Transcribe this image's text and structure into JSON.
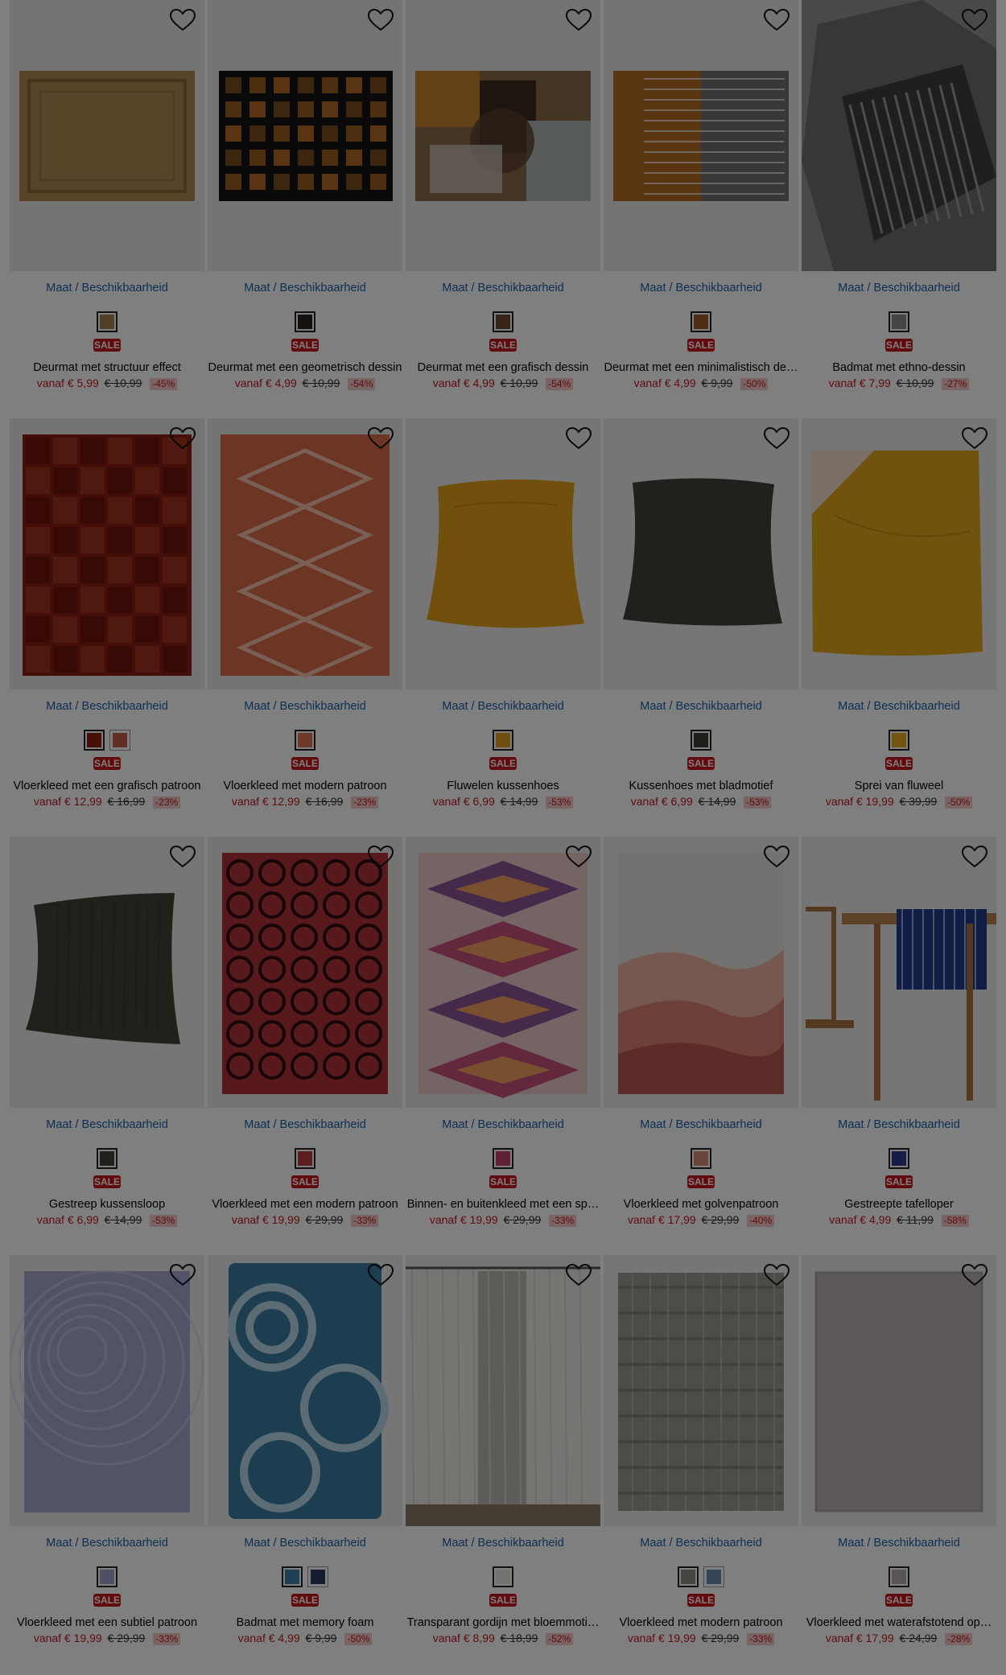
{
  "common": {
    "size_link": "Maat / Beschikbaarheid",
    "sale_badge": "SALE"
  },
  "products": [
    {
      "title": "Deurmat met structuur effect",
      "price": "vanaf € 5,99",
      "old": "€ 10,99",
      "pct": "-45%",
      "image": "jute-rug",
      "swatches": [
        "#a0824e"
      ]
    },
    {
      "title": "Deurmat met een geometrisch dessin",
      "price": "vanaf € 4,99",
      "old": "€ 10,99",
      "pct": "-54%",
      "image": "dark-orange-squares-rug",
      "swatches": [
        "#2b2016"
      ]
    },
    {
      "title": "Deurmat met een grafisch dessin",
      "price": "vanaf € 4,99",
      "old": "€ 10,99",
      "pct": "-54%",
      "image": "abstract-brown-rug",
      "swatches": [
        "#6a4a2c"
      ]
    },
    {
      "title": "Deurmat met een minimalistisch de…",
      "price": "vanaf € 4,99",
      "old": "€ 9,99",
      "pct": "-50%",
      "image": "orange-grey-stripes-rug",
      "swatches": [
        "#9a5c2a"
      ]
    },
    {
      "title": "Badmat met ethno-dessin",
      "price": "vanaf € 7,99",
      "old": "€ 10,99",
      "pct": "-27%",
      "image": "grey-ethno-bathmat",
      "swatches": [
        "#8a8a8a"
      ]
    },
    {
      "title": "Vloerkleed met een grafisch patroon",
      "price": "vanaf € 12,99",
      "old": "€ 16,99",
      "pct": "-23%",
      "image": "red-tile-rug",
      "swatches": [
        "#8c1e10",
        "#c26048"
      ]
    },
    {
      "title": "Vloerkleed met modern patroon",
      "price": "vanaf € 12,99",
      "old": "€ 16,99",
      "pct": "-23%",
      "image": "orange-diamond-rug",
      "swatches": [
        "#e07050"
      ]
    },
    {
      "title": "Fluwelen kussenhoes",
      "price": "vanaf € 6,99",
      "old": "€ 14,99",
      "pct": "-53%",
      "image": "yellow-cushion",
      "swatches": [
        "#e0a020"
      ]
    },
    {
      "title": "Kussenhoes met bladmotief",
      "price": "vanaf € 6,99",
      "old": "€ 14,99",
      "pct": "-53%",
      "image": "dark-green-cushion",
      "swatches": [
        "#3c3f36"
      ]
    },
    {
      "title": "Sprei van fluweel",
      "price": "vanaf € 19,99",
      "old": "€ 39,99",
      "pct": "-50%",
      "image": "yellow-bedspread",
      "swatches": [
        "#e2a820"
      ]
    },
    {
      "title": "Gestreep kussensloop",
      "price": "vanaf € 6,99",
      "old": "€ 14,99",
      "pct": "-53%",
      "image": "olive-cushion",
      "swatches": [
        "#3e4536"
      ]
    },
    {
      "title": "Vloerkleed met een modern patroon",
      "price": "vanaf € 19,99",
      "old": "€ 29,99",
      "pct": "-33%",
      "image": "red-circles-rug",
      "swatches": [
        "#b83c40"
      ]
    },
    {
      "title": "Binnen- en buitenkleed met een sp…",
      "price": "vanaf € 19,99",
      "old": "€ 29,99",
      "pct": "-33%",
      "image": "kilim-rug",
      "swatches": [
        "#c04070"
      ]
    },
    {
      "title": "Vloerkleed met golvenpatroon",
      "price": "vanaf € 17,99",
      "old": "€ 29,99",
      "pct": "-40%",
      "image": "wave-rug",
      "swatches": [
        "#d88878"
      ]
    },
    {
      "title": "Gestreepte tafelloper",
      "price": "vanaf € 4,99",
      "old": "€ 11,99",
      "pct": "-58%",
      "image": "table-runner",
      "swatches": [
        "#2a3a8c"
      ]
    },
    {
      "title": "Vloerkleed met een subtiel patroon",
      "price": "vanaf € 19,99",
      "old": "€ 29,99",
      "pct": "-33%",
      "image": "lilac-rug",
      "swatches": [
        "#9fa0c8"
      ]
    },
    {
      "title": "Badmat met memory foam",
      "price": "vanaf € 4,99",
      "old": "€ 9,99",
      "pct": "-50%",
      "image": "blue-swirl-bathmat",
      "swatches": [
        "#3a7ea8",
        "#2a3a60"
      ]
    },
    {
      "title": "Transparant gordijn met bloemmoti…",
      "price": "vanaf € 8,99",
      "old": "€ 18,99",
      "pct": "-52%",
      "image": "sheer-curtain",
      "swatches": [
        "#e8e6e0"
      ]
    },
    {
      "title": "Vloerkleed met modern patroon",
      "price": "vanaf € 19,99",
      "old": "€ 29,99",
      "pct": "-33%",
      "image": "grey-grid-rug",
      "swatches": [
        "#8c8c80",
        "#6a8ab0"
      ]
    },
    {
      "title": "Vloerkleed met waterafstotend op…",
      "price": "vanaf € 17,99",
      "old": "€ 24,99",
      "pct": "-28%",
      "image": "grey-plain-rug",
      "swatches": [
        "#b0aaa8"
      ]
    }
  ]
}
